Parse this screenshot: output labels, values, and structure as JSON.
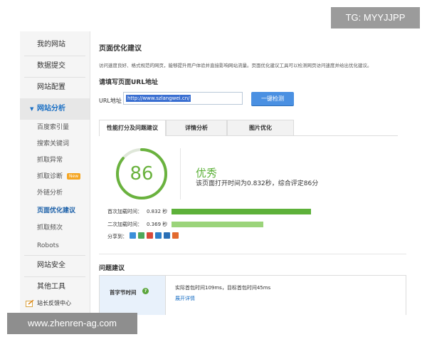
{
  "sidebar": {
    "items": [
      {
        "label": "我的网站"
      },
      {
        "label": "数据提交"
      },
      {
        "label": "网站配置"
      },
      {
        "label": "网站分析"
      },
      {
        "label": "网站安全"
      },
      {
        "label": "其他工具"
      }
    ],
    "sub_items": [
      {
        "label": "百度索引量"
      },
      {
        "label": "搜索关键词"
      },
      {
        "label": "抓取异常"
      },
      {
        "label": "抓取诊断",
        "badge": "New"
      },
      {
        "label": "外链分析"
      },
      {
        "label": "页面优化建议"
      },
      {
        "label": "抓取频次"
      },
      {
        "label": "Robots"
      }
    ],
    "feedback": "站长反馈中心"
  },
  "main": {
    "title": "页面优化建议",
    "description": "访问速度良好、格式规范的网页，能够提升用户体验并直接影响网站流量。页面优化建议工具可以检测网页访问速度并给出优化建议。",
    "url_section_title": "请填写页面URL地址",
    "url_label": "URL地址",
    "url_value": "http://www.szlangwei.cn/",
    "check_button": "一键检测",
    "tabs": [
      {
        "label": "性能打分及问题建议"
      },
      {
        "label": "详情分析"
      },
      {
        "label": "图片优化"
      }
    ],
    "score": "86",
    "score_fraction": 0.86,
    "grade": "优秀",
    "grade_desc": "该页面打开时间为0.832秒，综合评定86分",
    "load_times": [
      {
        "label": "首次加载时间：",
        "value": "0.832 秒",
        "fraction": 1.0
      },
      {
        "label": "二次加载时间：",
        "value": "0.369 秒",
        "fraction": 0.66
      }
    ],
    "share_label": "分享到：",
    "share_icons": [
      "plus-share-icon",
      "qzone-share-icon",
      "weibo-share-icon",
      "tencent-share-icon",
      "renren-share-icon",
      "kaixin-share-icon"
    ],
    "issues_title": "问题建议",
    "issue": {
      "name": "首字节时间",
      "detail": "实际首包时间109ms，目标首包时间45ms",
      "link": "展开详情"
    }
  },
  "colors": {
    "accent_blue": "#4a90e2",
    "score_green": "#6ab23e",
    "bar_first": "#5db13a",
    "bar_second": "#9bd47a",
    "active_nav": "#1a6fc4"
  },
  "watermarks": {
    "top_right": "TG: MYYJJPP",
    "bottom_left": "www.zhenren-ag.com"
  }
}
